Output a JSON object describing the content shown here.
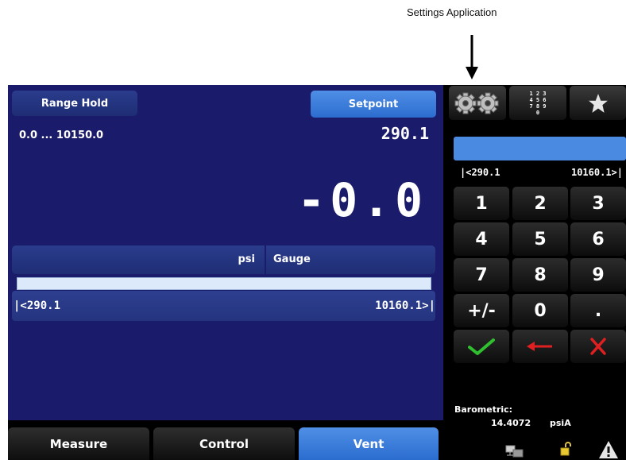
{
  "callout": {
    "label": "Settings Application"
  },
  "main": {
    "range_hold_label": "Range Hold",
    "setpoint_label": "Setpoint",
    "range_text": "0.0 ... 10150.0",
    "setpoint_value": "290.1",
    "reading": "-0.0",
    "unit": "psi",
    "mode": "Gauge",
    "limit_low": "|<290.1",
    "limit_high": "10160.1>|"
  },
  "tabs": [
    {
      "label": "Measure",
      "active": false
    },
    {
      "label": "Control",
      "active": false
    },
    {
      "label": "Vent",
      "active": true
    }
  ],
  "right_panel": {
    "icons": [
      "gear-icon",
      "numpad-icon",
      "star-icon"
    ],
    "numpad_icon_text": "1 2 3\n4 5 6\n7 8 9\n0",
    "keypad_limit_low": "|<290.1",
    "keypad_limit_high": "10160.1>|",
    "keys": [
      "1",
      "2",
      "3",
      "4",
      "5",
      "6",
      "7",
      "8",
      "9",
      "+/-",
      "0",
      "."
    ],
    "barometric_label": "Barometric:",
    "barometric_value": "14.4072",
    "barometric_unit": "psiA"
  },
  "colors": {
    "main_background": "#1b1b6b",
    "accent_blue": "#3a7ddc",
    "confirm_green": "#2fbf2f",
    "cancel_red": "#e02020"
  }
}
